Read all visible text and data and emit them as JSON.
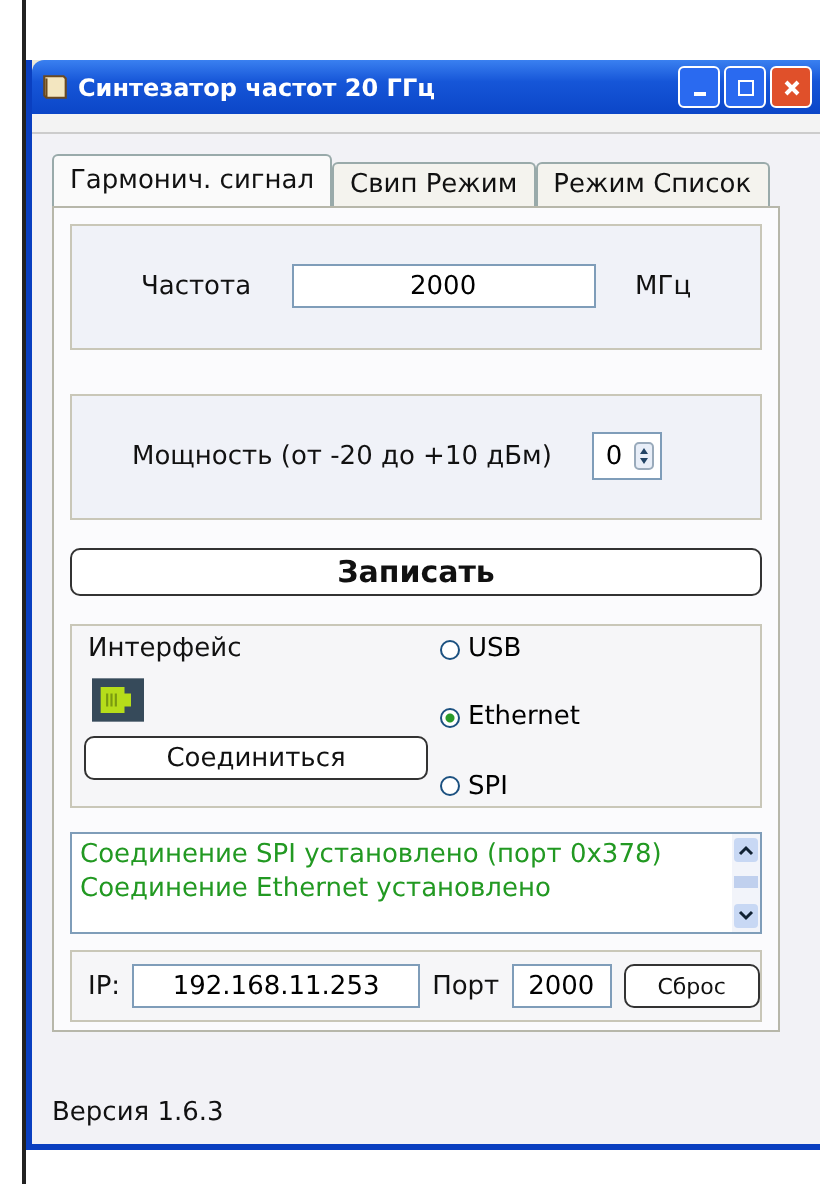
{
  "window": {
    "title": "Синтезатор частот 20 ГГц"
  },
  "tabs": [
    {
      "label": "Гармонич. сигнал",
      "selected": true
    },
    {
      "label": "Свип Режим",
      "selected": false
    },
    {
      "label": "Режим Список",
      "selected": false
    }
  ],
  "frequency": {
    "label": "Частота",
    "value": "2000",
    "unit": "МГц"
  },
  "power": {
    "label": "Мощность (от -20 до +10 дБм)",
    "value": "0"
  },
  "write_button": "Записать",
  "interface": {
    "label": "Интерфейс",
    "connect_button": "Соединиться",
    "options": [
      {
        "label": "USB",
        "selected": false
      },
      {
        "label": "Ethernet",
        "selected": true
      },
      {
        "label": "SPI",
        "selected": false
      }
    ]
  },
  "log": [
    "Соединение SPI установлено (порт 0x378)",
    "Соединение Ethernet установлено"
  ],
  "network": {
    "ip_label": "IP:",
    "ip": "192.168.11.253",
    "port_label": "Порт",
    "port": "2000",
    "reset_button": "Сброс"
  },
  "status_bar": "Версия 1.6.3"
}
